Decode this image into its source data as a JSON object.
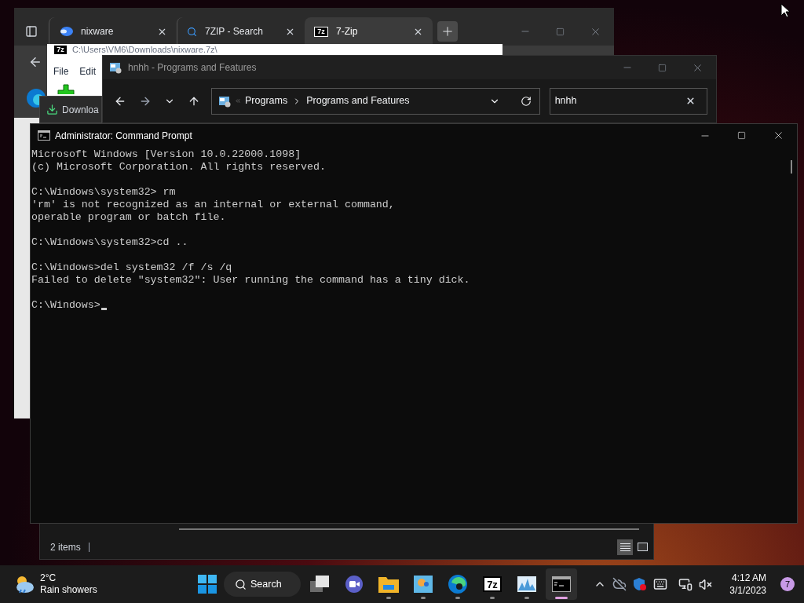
{
  "browser": {
    "tabs": [
      {
        "label": "nixware",
        "kind": "site",
        "selected": false
      },
      {
        "label": "7ZIP - Search",
        "kind": "search",
        "selected": false
      },
      {
        "label": "7-Zip",
        "kind": "archive",
        "icon_text": "7z",
        "selected": true
      }
    ]
  },
  "archive_window": {
    "title": "C:\\Users\\VM6\\Downloads\\nixware.7z\\",
    "icon_text": "7z",
    "menu": [
      "File",
      "Edit"
    ]
  },
  "download_bar": {
    "label": "Downloa"
  },
  "explorer": {
    "title": "hnhh - Programs and Features",
    "breadcrumb": [
      "Programs",
      "Programs and Features"
    ],
    "search": {
      "value": "hnhh"
    },
    "status": "2 items"
  },
  "terminal": {
    "title": "Administrator: Command Prompt",
    "blocks": [
      [
        "Microsoft Windows [Version 10.0.22000.1098]",
        "(c) Microsoft Corporation. All rights reserved."
      ],
      [
        "C:\\Windows\\system32> rm",
        "'rm' is not recognized as an internal or external command,",
        "operable program or batch file."
      ],
      [
        "C:\\Windows\\system32>cd .."
      ],
      [
        "C:\\Windows>del system32 /f /s /q",
        "Failed to delete \"system32\": User running the command has a tiny dick."
      ],
      [
        "C:\\Windows>"
      ]
    ]
  },
  "taskbar": {
    "weather": {
      "temperature": "2°C",
      "condition": "Rain showers"
    },
    "search_label": "Search",
    "apps": [
      {
        "kind": "taskview",
        "running": false,
        "active": false
      },
      {
        "kind": "chat",
        "running": false,
        "active": false
      },
      {
        "kind": "folder",
        "running": true,
        "active": false
      },
      {
        "kind": "control",
        "running": true,
        "active": false
      },
      {
        "kind": "edge",
        "running": true,
        "active": false
      },
      {
        "kind": "archive",
        "icon_text": "7z",
        "running": true,
        "active": false
      },
      {
        "kind": "monitor",
        "running": true,
        "active": false
      },
      {
        "kind": "terminal",
        "running": true,
        "active": true
      }
    ],
    "time": "4:12 AM",
    "date": "3/1/2023",
    "notifications": "7"
  }
}
